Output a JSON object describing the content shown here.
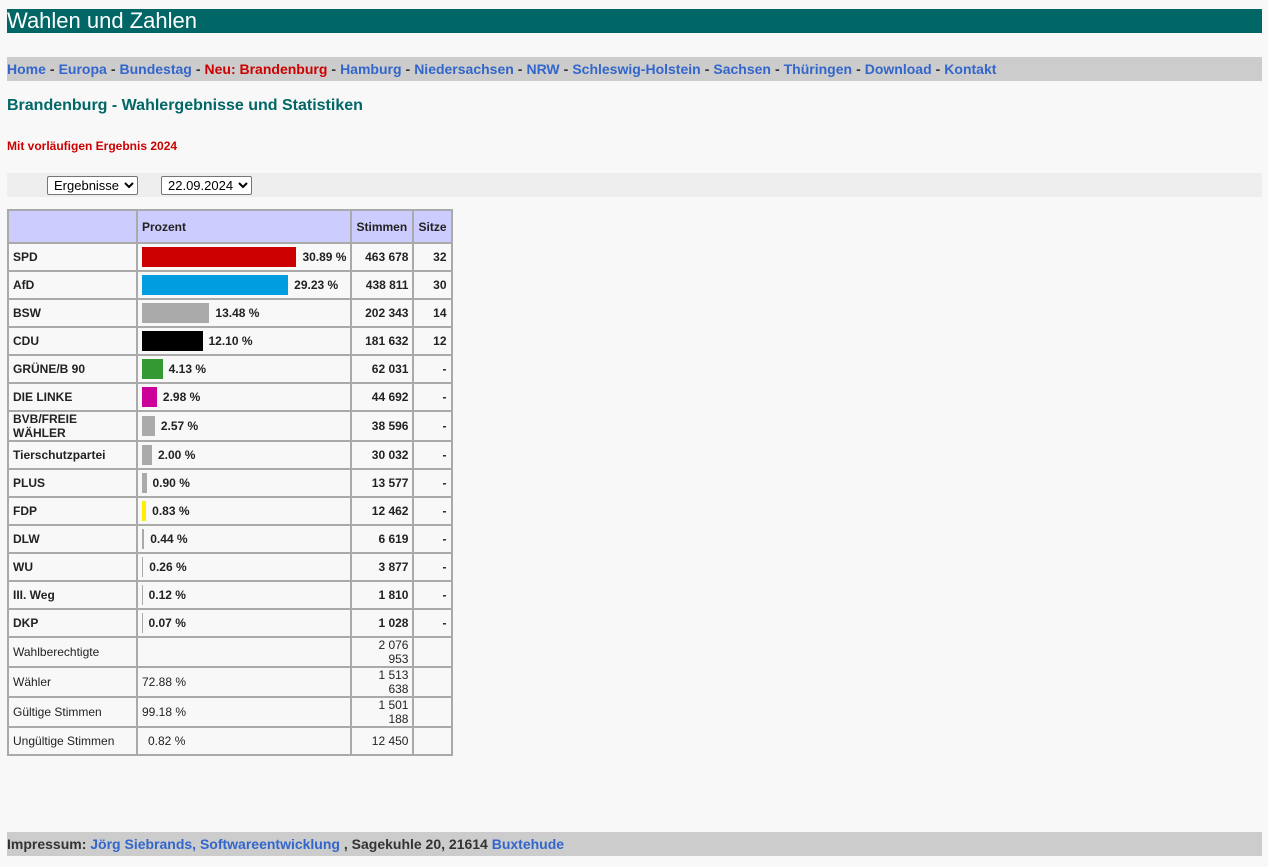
{
  "header": {
    "title": "Wahlen und Zahlen"
  },
  "nav": {
    "items": [
      {
        "label": "Home",
        "active": false
      },
      {
        "label": "Europa",
        "active": false
      },
      {
        "label": "Bundestag",
        "active": false
      },
      {
        "label": "Neu: Brandenburg",
        "active": true
      },
      {
        "label": "Hamburg",
        "active": false
      },
      {
        "label": "Niedersachsen",
        "active": false
      },
      {
        "label": "NRW",
        "active": false
      },
      {
        "label": "Schleswig-Holstein",
        "active": false
      },
      {
        "label": "Sachsen",
        "active": false
      },
      {
        "label": "Thüringen",
        "active": false
      },
      {
        "label": "Download",
        "active": false
      },
      {
        "label": "Kontakt",
        "active": false
      }
    ],
    "separator": "-"
  },
  "page": {
    "title": "Brandenburg - Wahlergebnisse und Statistiken",
    "subtitle": "Mit vorläufigen Ergebnis 2024"
  },
  "selectors": {
    "view": "Ergebnisse",
    "date": "22.09.2024"
  },
  "table": {
    "headers": {
      "party": "",
      "percent": "Prozent",
      "votes": "Stimmen",
      "seats": "Sitze"
    },
    "parties": [
      {
        "name": "SPD",
        "percent": 30.89,
        "percent_label": "30.89 %",
        "votes": "463 678",
        "seats": "32",
        "color": "#cc0000"
      },
      {
        "name": "AfD",
        "percent": 29.23,
        "percent_label": "29.23 %",
        "votes": "438 811",
        "seats": "30",
        "color": "#009ee0"
      },
      {
        "name": "BSW",
        "percent": 13.48,
        "percent_label": "13.48 %",
        "votes": "202 343",
        "seats": "14",
        "color": "#aaaaaa"
      },
      {
        "name": "CDU",
        "percent": 12.1,
        "percent_label": "12.10 %",
        "votes": "181 632",
        "seats": "12",
        "color": "#000000"
      },
      {
        "name": "GRÜNE/B 90",
        "percent": 4.13,
        "percent_label": "4.13 %",
        "votes": "62 031",
        "seats": "-",
        "color": "#339933"
      },
      {
        "name": "DIE LINKE",
        "percent": 2.98,
        "percent_label": "2.98 %",
        "votes": "44 692",
        "seats": "-",
        "color": "#cc0099"
      },
      {
        "name": "BVB/FREIE WÄHLER",
        "percent": 2.57,
        "percent_label": "2.57 %",
        "votes": "38 596",
        "seats": "-",
        "color": "#aaaaaa"
      },
      {
        "name": "Tierschutzpartei",
        "percent": 2.0,
        "percent_label": "2.00 %",
        "votes": "30 032",
        "seats": "-",
        "color": "#aaaaaa"
      },
      {
        "name": "PLUS",
        "percent": 0.9,
        "percent_label": "0.90 %",
        "votes": "13 577",
        "seats": "-",
        "color": "#aaaaaa"
      },
      {
        "name": "FDP",
        "percent": 0.83,
        "percent_label": "0.83 %",
        "votes": "12 462",
        "seats": "-",
        "color": "#ffee00"
      },
      {
        "name": "DLW",
        "percent": 0.44,
        "percent_label": "0.44 %",
        "votes": "6 619",
        "seats": "-",
        "color": "#aaaaaa"
      },
      {
        "name": "WU",
        "percent": 0.26,
        "percent_label": "0.26 %",
        "votes": "3 877",
        "seats": "-",
        "color": "#aaaaaa"
      },
      {
        "name": "III. Weg",
        "percent": 0.12,
        "percent_label": "0.12 %",
        "votes": "1 810",
        "seats": "-",
        "color": "#aaaaaa"
      },
      {
        "name": "DKP",
        "percent": 0.07,
        "percent_label": "0.07 %",
        "votes": "1 028",
        "seats": "-",
        "color": "#aaaaaa"
      }
    ],
    "stats": [
      {
        "label": "Wahlberechtigte",
        "percent": "",
        "value": "2 076 953"
      },
      {
        "label": "Wähler",
        "percent": "72.88 %",
        "value": "1 513 638"
      },
      {
        "label": "Gültige Stimmen",
        "percent": "99.18 %",
        "value": "1 501 188"
      },
      {
        "label": "Ungültige Stimmen",
        "percent": "0.82 %",
        "value": "12 450"
      }
    ]
  },
  "footer": {
    "label": "Impressum:",
    "company": "Jörg Siebrands, Softwareentwicklung",
    "address": ", Sagekuhle 20, 21614",
    "city": "Buxtehude"
  }
}
